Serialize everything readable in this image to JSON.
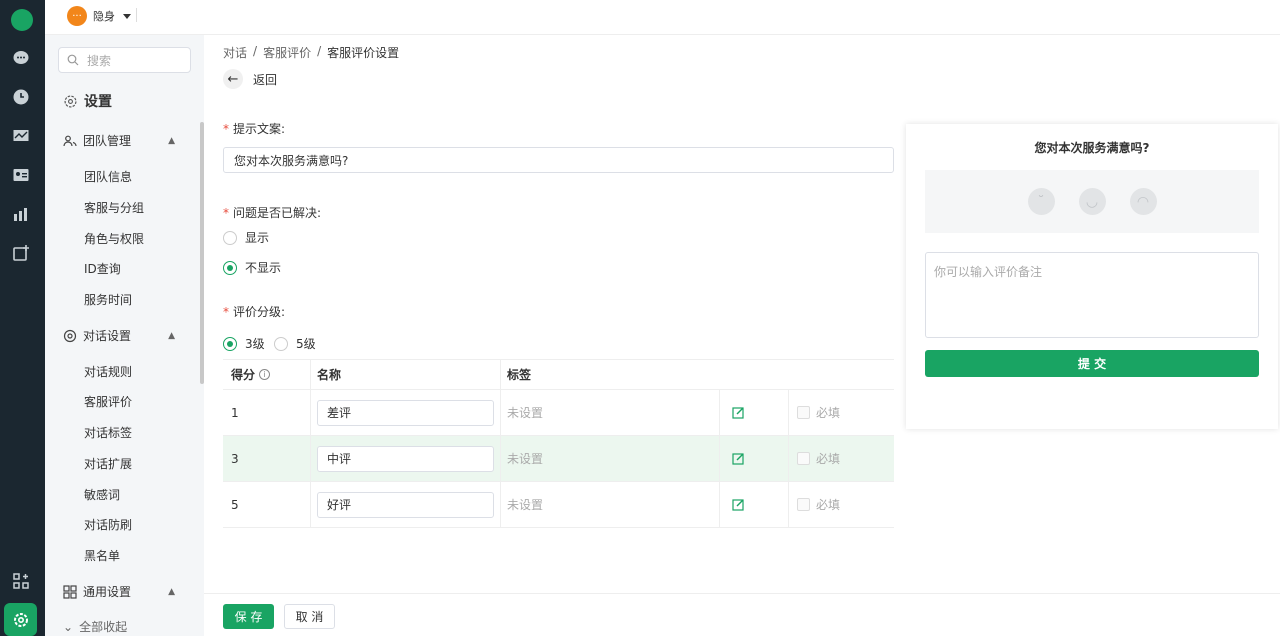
{
  "topbar": {
    "status_label": "隐身",
    "avatar_icon": "chat-bubble-icon"
  },
  "sidebar": {
    "search_placeholder": "搜索",
    "title": "设置",
    "groups": [
      {
        "label": "团队管理",
        "items": [
          "团队信息",
          "客服与分组",
          "角色与权限",
          "ID查询",
          "服务时间"
        ]
      },
      {
        "label": "对话设置",
        "items": [
          "对话规则",
          "客服评价",
          "对话标签",
          "对话扩展",
          "敏感词",
          "对话防刷",
          "黑名单"
        ]
      },
      {
        "label": "通用设置",
        "items": []
      }
    ],
    "collapse_label": "全部收起"
  },
  "breadcrumb": {
    "items": [
      "对话",
      "客服评价",
      "客服评价设置"
    ],
    "sep": "/"
  },
  "back_label": "返回",
  "form": {
    "prompt_label": "提示文案:",
    "prompt_value": "您对本次服务满意吗?",
    "resolved_label": "问题是否已解决:",
    "resolved_options": [
      "显示",
      "不显示"
    ],
    "resolved_selected": "不显示",
    "levels_label": "评价分级:",
    "level_options": [
      "3级",
      "5级"
    ],
    "level_selected": "3级"
  },
  "table": {
    "headers": [
      "得分",
      "名称",
      "标签"
    ],
    "rows": [
      {
        "score": "1",
        "name": "差评",
        "tag": "未设置",
        "required": "必填"
      },
      {
        "score": "3",
        "name": "中评",
        "tag": "未设置",
        "required": "必填"
      },
      {
        "score": "5",
        "name": "好评",
        "tag": "未设置",
        "required": "必填"
      }
    ]
  },
  "footer": {
    "save": "保 存",
    "cancel": "取 消"
  },
  "preview": {
    "question": "您对本次服务满意吗?",
    "faces": [
      "sad-face-icon",
      "neutral-face-icon",
      "happy-face-icon"
    ],
    "textarea_placeholder": "你可以输入评价备注",
    "submit": "提 交"
  },
  "colors": {
    "accent": "#19a463",
    "rail": "#1b2730",
    "highlight_row": "#ecf7ef"
  }
}
